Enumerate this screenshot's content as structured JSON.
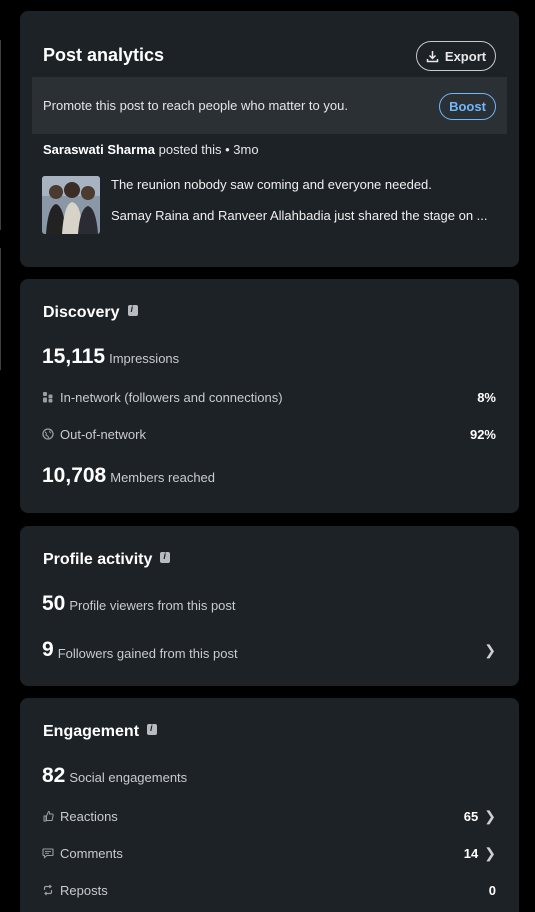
{
  "post_analytics": {
    "title": "Post analytics",
    "export_label": "Export",
    "promo_text": "Promote this post to reach people who matter to you.",
    "boost_label": "Boost",
    "author": "Saraswati Sharma",
    "posted_text": "posted this • 3mo",
    "post_line1": "The reunion nobody saw coming and everyone needed.",
    "post_line2": "Samay Raina and Ranveer Allahbadia just shared the stage on ..."
  },
  "discovery": {
    "title": "Discovery",
    "impressions_value": "15,115",
    "impressions_label": "Impressions",
    "in_network_label": "In-network (followers and connections)",
    "in_network_value": "8%",
    "out_network_label": "Out-of-network",
    "out_network_value": "92%",
    "members_value": "10,708",
    "members_label": "Members reached"
  },
  "profile_activity": {
    "title": "Profile activity",
    "viewers_value": "50",
    "viewers_label": "Profile viewers from this post",
    "followers_value": "9",
    "followers_label": "Followers gained from this post"
  },
  "engagement": {
    "title": "Engagement",
    "social_value": "82",
    "social_label": "Social engagements",
    "reactions_label": "Reactions",
    "reactions_value": "65",
    "comments_label": "Comments",
    "comments_value": "14",
    "reposts_label": "Reposts",
    "reposts_value": "0"
  },
  "icons": {
    "export": "download-icon",
    "info": "info-icon",
    "in_network": "people-icon",
    "out_network": "globe-icon",
    "reactions": "like-icon",
    "comments": "comment-icon",
    "reposts": "repost-icon",
    "chevron": "chevron-right-icon"
  },
  "colors": {
    "background": "#000000",
    "card": "#1d2226",
    "promo_bg": "#2a3034",
    "accent_blue": "#71b7fb"
  }
}
